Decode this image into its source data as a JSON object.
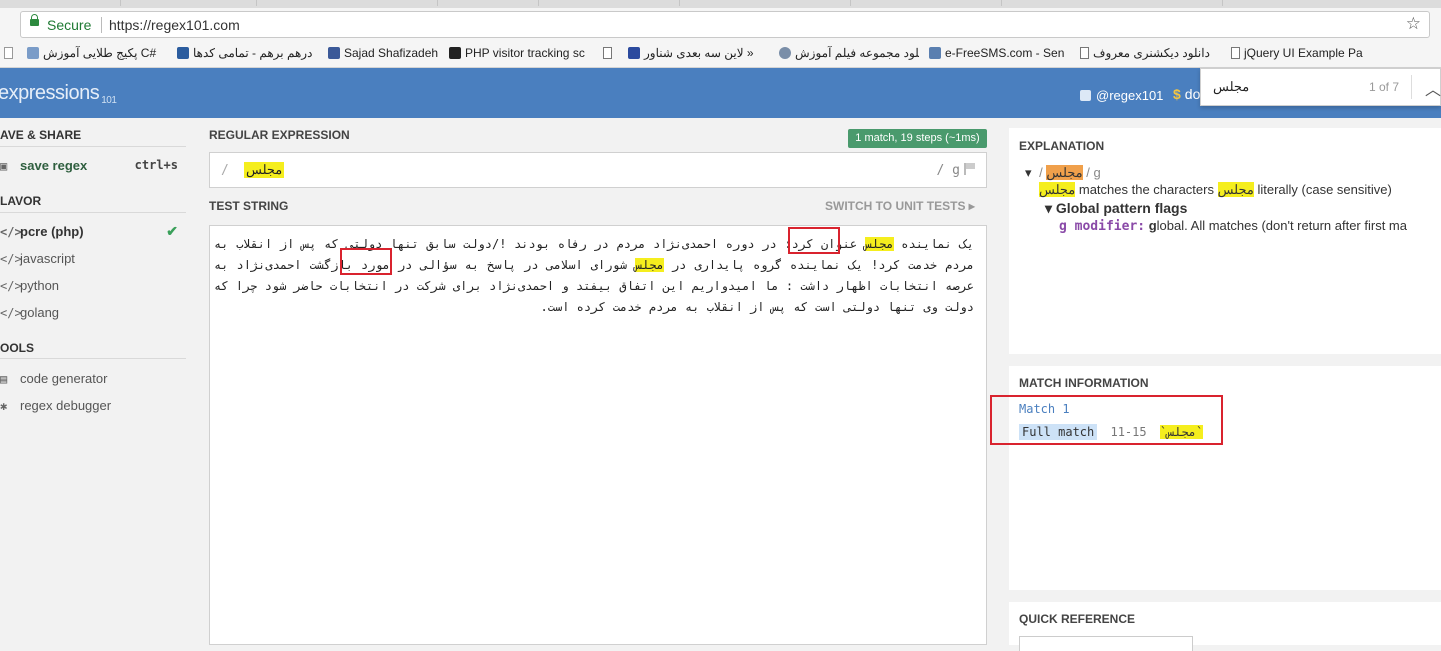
{
  "browser": {
    "secure_label": "Secure",
    "url": "https://regex101.com",
    "bookmarks": [
      {
        "label": "پکیج طلایی آموزش C#"
      },
      {
        "label": "درهم برهم - تمامی کدها"
      },
      {
        "label": "Sajad Shafizadeh"
      },
      {
        "label": "PHP visitor tracking sc"
      },
      {
        "label": "لاین سه بعدی شناور »"
      },
      {
        "label": "دانلود مجموعه فیلم آموزش"
      },
      {
        "label": "e-FreeSMS.com - Sen"
      },
      {
        "label": "دانلود دیکشنری معروف"
      },
      {
        "label": "jQuery UI Example Pa"
      }
    ]
  },
  "find": {
    "query": "مجلس",
    "count": "1 of 7"
  },
  "header": {
    "logo": "expressions",
    "logo_sup": "101",
    "twitter": "@regex101",
    "donate_symbol": "$",
    "donate": "do"
  },
  "sidebar": {
    "save_title": "AVE & SHARE",
    "save_label": "save regex",
    "save_shortcut": "ctrl+s",
    "flavor_title": "LAVOR",
    "flavors": [
      "pcre (php)",
      "javascript",
      "python",
      "golang"
    ],
    "flavor_icon": "</>",
    "tools_title": "OOLS",
    "tools": [
      "code generator",
      "regex debugger"
    ]
  },
  "editor": {
    "regex_title": "REGULAR EXPRESSION",
    "match_status": "1 match, 19 steps (~1ms)",
    "delimiter_open": "/",
    "regex_value": "مجلس",
    "regex_flags": "/ g",
    "test_title": "TEST STRING",
    "switch_label": "SWITCH TO UNIT TESTS",
    "test_parts": [
      "یک نماینده ",
      "مجلس",
      " عنوان کرد: در دوره احمدی‌نژاد مردم در رفاه بودند !/دولت سابق تنها دولتی که پس از انقلاب به مردم خدمت کرد! یک نماینده گروه پایداری در ",
      "مجلس",
      " شورای اسلامی در پاسخ به سؤالی در مورد بازگشت احمدی‌نژاد به عرصه انتخابات اظهار داشت : ما امیدواریم این اتفاق بیفتد و احمدی‌نژاد برای شرکت در انتخابات حاضر شود چرا که دولت وی تنها دولتی است که پس از انقلاب به مردم خدمت کرده است."
    ]
  },
  "explanation": {
    "title": "EXPLANATION",
    "tree_open": "/",
    "token": "مجلس",
    "tree_close": "/ g",
    "literal_prefix": "matches the characters",
    "literal_suffix": "literally (case sensitive)",
    "flags_title": "Global pattern flags",
    "modifier_label": "g modifier:",
    "modifier_g": "g",
    "modifier_text": "lobal. All matches (don't return after first ma"
  },
  "match_info": {
    "title": "MATCH INFORMATION",
    "match_label": "Match 1",
    "full_label": "Full match",
    "range": "11-15",
    "value": "`مجلس`"
  },
  "quick_ref": {
    "title": "QUICK REFERENCE"
  },
  "colors": {
    "header_blue": "#4a7fbf",
    "match_green": "#4a9a6d",
    "highlight_yellow": "#f5ee1e",
    "token_orange": "#f0a04b",
    "annotation_red": "#d9232e"
  }
}
